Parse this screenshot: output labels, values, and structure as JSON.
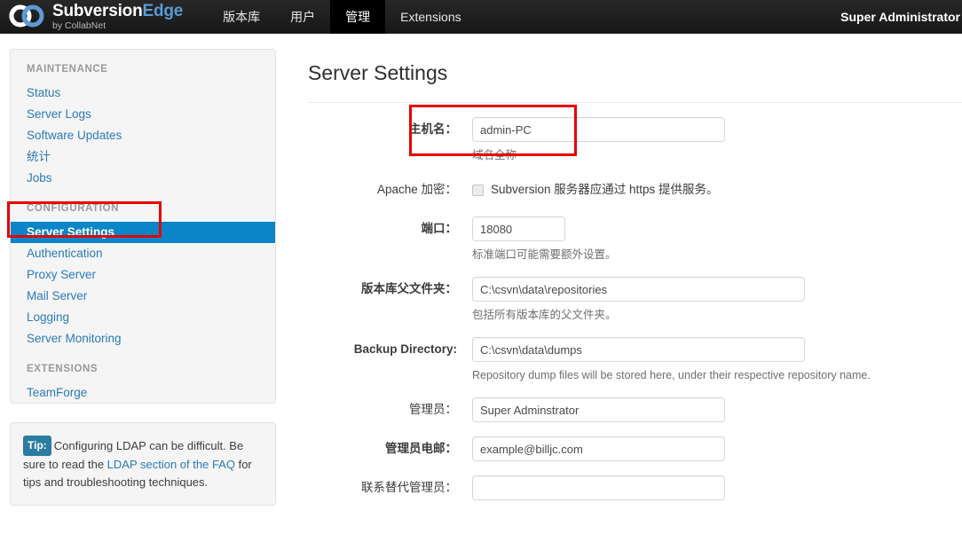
{
  "topbar": {
    "logo_icon": "collabnet-rings-logo",
    "brand_word1": "Subversion",
    "brand_word2": "Edge",
    "brand_tagline": "by CollabNet",
    "nav": [
      {
        "label": "版本库",
        "active": false
      },
      {
        "label": "用户",
        "active": false
      },
      {
        "label": "管理",
        "active": true
      },
      {
        "label": "Extensions",
        "active": false
      }
    ],
    "user": "Super Administrator"
  },
  "sidebar": {
    "groups": [
      {
        "title": "MAINTENANCE",
        "items": [
          {
            "label": "Status",
            "selected": false
          },
          {
            "label": "Server Logs",
            "selected": false
          },
          {
            "label": "Software Updates",
            "selected": false
          },
          {
            "label": "统计",
            "selected": false
          },
          {
            "label": "Jobs",
            "selected": false
          }
        ]
      },
      {
        "title": "CONFIGURATION",
        "items": [
          {
            "label": "Server Settings",
            "selected": true
          },
          {
            "label": "Authentication",
            "selected": false
          },
          {
            "label": "Proxy Server",
            "selected": false
          },
          {
            "label": "Mail Server",
            "selected": false
          },
          {
            "label": "Logging",
            "selected": false
          },
          {
            "label": "Server Monitoring",
            "selected": false
          }
        ]
      },
      {
        "title": "EXTENSIONS",
        "items": [
          {
            "label": "TeamForge",
            "selected": false
          }
        ]
      }
    ],
    "tip": {
      "badge": "Tip:",
      "text_before": "Configuring LDAP can be difficult. Be sure to read the ",
      "link": "LDAP section of the FAQ",
      "text_after": " for tips and troubleshooting techniques."
    }
  },
  "main": {
    "title": "Server Settings",
    "fields": {
      "hostname": {
        "label": "主机名：",
        "value": "admin-PC",
        "help": "域名全称"
      },
      "apache_encryption": {
        "label": "Apache 加密：",
        "checkbox_label": "Subversion 服务器应通过 https 提供服务。",
        "checked": false
      },
      "port": {
        "label": "端口：",
        "value": "18080",
        "help": "标准端口可能需要额外设置。"
      },
      "repo_parent": {
        "label": "版本库父文件夹：",
        "value": "C:\\csvn\\data\\repositories",
        "help": "包括所有版本库的父文件夹。"
      },
      "backup_dir": {
        "label": "Backup Directory:",
        "value": "C:\\csvn\\data\\dumps",
        "help": "Repository dump files will be stored here, under their respective repository name."
      },
      "administrator": {
        "label": "管理员：",
        "value": "Super Adminstrator"
      },
      "admin_email": {
        "label": "管理员电邮：",
        "value": "example@billjc.com"
      },
      "alt_admin": {
        "label": "联系替代管理员：",
        "value": ""
      }
    }
  },
  "annotations": {
    "accent_color": "#e60000",
    "sidebar_highlight": "server-settings-nav-item",
    "hostname_highlight": "hostname-field"
  }
}
